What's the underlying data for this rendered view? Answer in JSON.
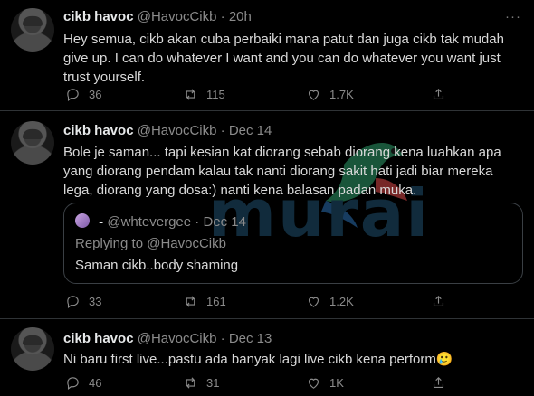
{
  "tweets": [
    {
      "name": "cikb havoc",
      "handle": "@HavocCikb",
      "sep": "·",
      "time": "20h",
      "more": "···",
      "text": "Hey semua, cikb akan cuba perbaiki mana patut dan juga cikb tak mudah give up. I can do whatever I want and you can do whatever you want just trust yourself.",
      "replies": "36",
      "retweets": "115",
      "likes": "1.7K"
    },
    {
      "name": "cikb havoc",
      "handle": "@HavocCikb",
      "sep": "·",
      "time": "Dec 14",
      "more": "···",
      "text": "Bole je saman... tapi kesian kat diorang sebab diorang kena luahkan apa yang diorang pendam kalau tak nanti diorang sakit hati jadi biar mereka lega, diorang yang dosa:) nanti kena balasan padan muka.",
      "quote": {
        "name": "-",
        "handle": "@whtevergee",
        "sep": "·",
        "time": "Dec 14",
        "replying": "Replying to @HavocCikb",
        "text": "Saman cikb..body shaming"
      },
      "replies": "33",
      "retweets": "161",
      "likes": "1.2K"
    },
    {
      "name": "cikb havoc",
      "handle": "@HavocCikb",
      "sep": "·",
      "time": "Dec 13",
      "more": "···",
      "text": "Ni baru first live...pastu ada banyak lagi live cikb kena perform🥲",
      "replies": "46",
      "retweets": "31",
      "likes": "1K"
    }
  ],
  "watermark": "murai",
  "colors": {
    "background": "#000000",
    "text": "#d9d9d9",
    "muted": "#8b8b8b",
    "divider": "#2f3336"
  },
  "icons": [
    "reply-icon",
    "retweet-icon",
    "like-icon",
    "share-icon",
    "more-icon"
  ]
}
